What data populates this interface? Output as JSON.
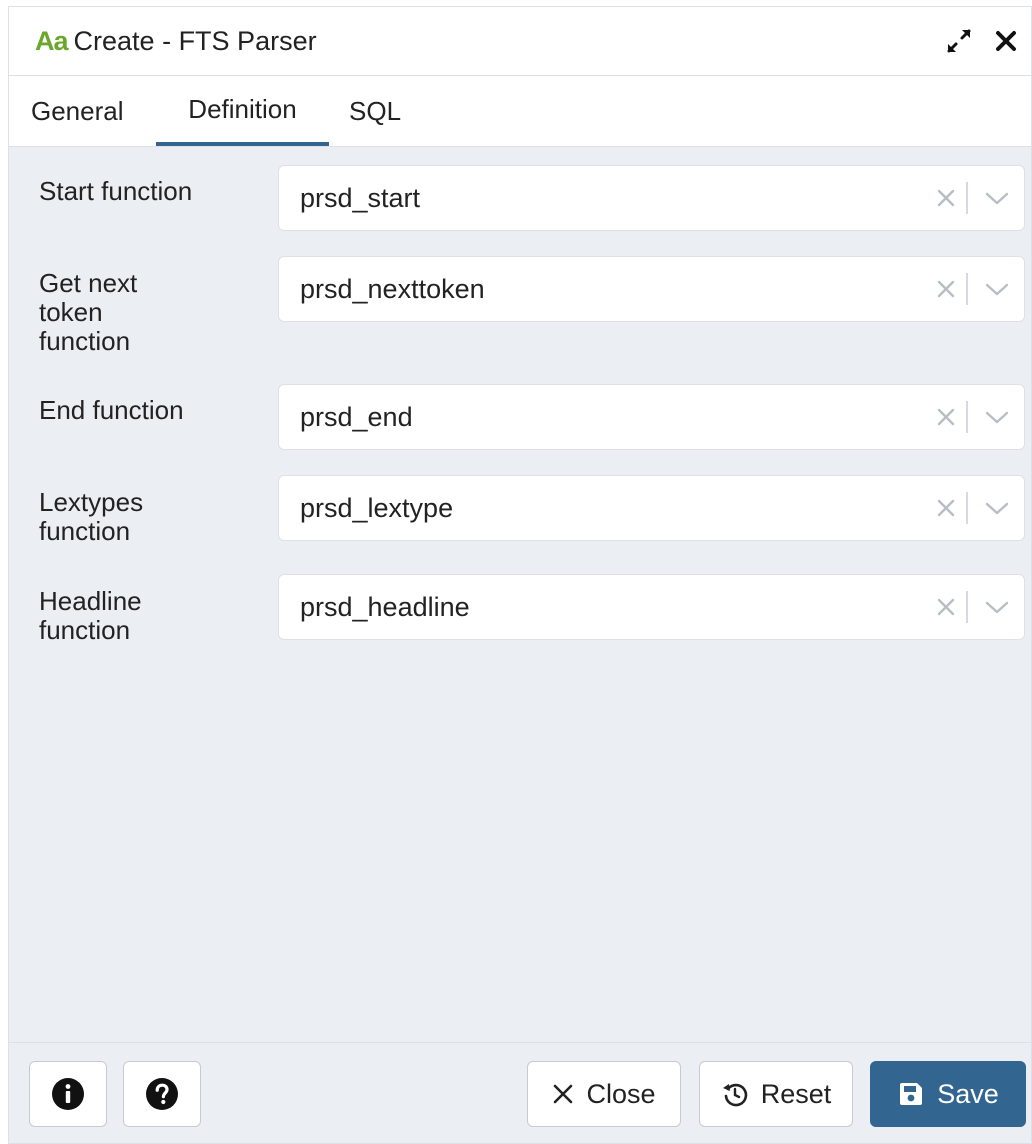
{
  "dialog": {
    "title_icon": "Aa",
    "title": "Create - FTS Parser",
    "icons": {
      "title": "font-aa-icon",
      "expand": "expand-icon",
      "close": "close-icon"
    }
  },
  "tabs": [
    {
      "label": "General",
      "active": false
    },
    {
      "label": "Definition",
      "active": true
    },
    {
      "label": "SQL",
      "active": false
    }
  ],
  "fields": [
    {
      "label": "Start function",
      "value": "prsd_start"
    },
    {
      "label": "Get next token function",
      "value": "prsd_nexttoken"
    },
    {
      "label": "End function",
      "value": "prsd_end"
    },
    {
      "label": "Lextypes function",
      "value": "prsd_lextype"
    },
    {
      "label": "Headline function",
      "value": "prsd_headline"
    }
  ],
  "footer": {
    "info_icon": "info-icon",
    "help_icon": "help-icon",
    "close_label": "Close",
    "reset_label": "Reset",
    "save_label": "Save"
  },
  "colors": {
    "accent": "#326690",
    "title_icon_green": "#6aa72b",
    "title_icon_dark": "#222222",
    "panel_bg": "#ebeef3"
  }
}
